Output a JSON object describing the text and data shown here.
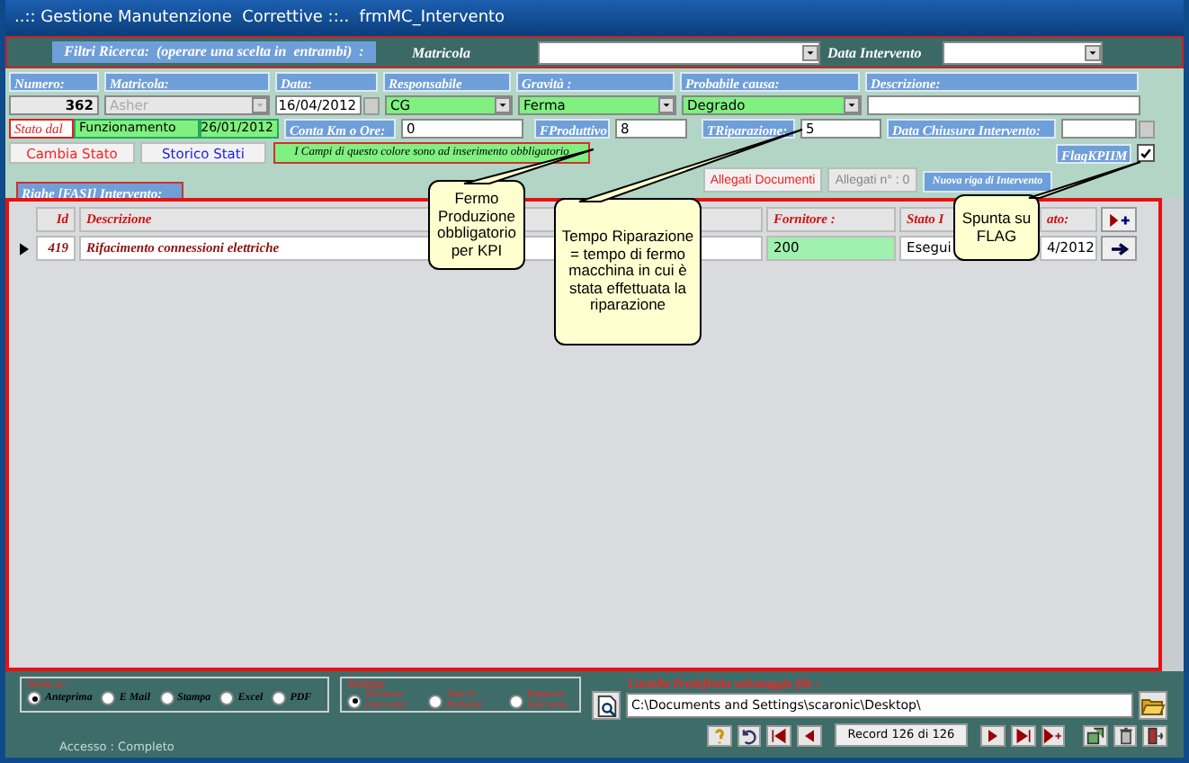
{
  "window": {
    "title": "..:: Gestione Manutenzione  Correttive ::..  frmMC_Intervento"
  },
  "filter_bar": {
    "label": "Filtri Ricerca:  (operare una scelta in  entrambi)  :",
    "fields": [
      {
        "label": "Matricola"
      },
      {
        "label": "Data Intervento"
      }
    ]
  },
  "form": {
    "numero": {
      "label": "Numero:",
      "value": "362"
    },
    "matricola": {
      "label": "Matricola:",
      "value": "Asher",
      "disabled": true
    },
    "data": {
      "label": "Data:",
      "value": "16/04/2012"
    },
    "responsabile": {
      "label": "Responsabile",
      "value": "CG",
      "required": true
    },
    "gravita": {
      "label": "Gravità :",
      "value": "Ferma",
      "required": true
    },
    "causa": {
      "label": "Probabile causa:",
      "value": "Degrado",
      "required": true
    },
    "descrizione": {
      "label": "Descrizione:"
    },
    "stato": {
      "label": "Stato dal",
      "value": "Funzionamento",
      "date": "26/01/2012",
      "required": true
    },
    "conta_km": {
      "label": "Conta Km o Ore:",
      "value": "0"
    },
    "fproduttivo": {
      "label": "FProduttivo",
      "value": "8"
    },
    "triparazione": {
      "label": "TRiparazione:",
      "value": "5"
    },
    "data_chiusura": {
      "label": "Data Chiusura Intervento:"
    },
    "state_buttons": [
      {
        "label": "Cambia Stato",
        "color": "#ff2020"
      },
      {
        "label": "Storico Stati",
        "color": "#2020e0"
      }
    ],
    "notice": "I Campi di questo colore sono ad inserimento obbligatorio",
    "flag": {
      "label": "FlagKPIIM",
      "checked": true
    },
    "attach_buttons": [
      {
        "label": "Allegati Documenti",
        "disabled": false
      },
      {
        "label": "Allegati n° : 0",
        "disabled": true
      }
    ],
    "new_row_button": "Nuova riga di Intervento",
    "rows_label": "Righe [FASI] Intervento:"
  },
  "subform": {
    "columns": {
      "id": "Id",
      "descrizione": "Descrizione",
      "fornitore": "Fornitore :",
      "column_5": "Stato I",
      "column_6": "ato:"
    },
    "rows": [
      {
        "selected": true,
        "id": "419",
        "descrizione": "Rifacimento connessioni elettriche",
        "fornitore": "200",
        "column_5": "Esegui",
        "column_6": "4/2012"
      }
    ]
  },
  "callouts": [
    {
      "text": "Fermo Produzione obbligatorio per KPI"
    },
    {
      "text": "Tempo Riparazione = tempo di fermo macchina in cui è stata effettuata la riparazione"
    },
    {
      "text": "Spunta su FLAG"
    }
  ],
  "send_to": {
    "label": "Invia a :",
    "options": [
      {
        "label": "Anteprima",
        "selected": true
      },
      {
        "label": "E Mail",
        "selected": false
      },
      {
        "label": "Stampa",
        "selected": false
      },
      {
        "label": "Excel",
        "selected": false
      },
      {
        "label": "PDF",
        "selected": false
      }
    ]
  },
  "print": {
    "label": "Stampa",
    "options": [
      {
        "label": "Richiesta Intervento",
        "selected": true
      },
      {
        "label": "Tutte le Richieste",
        "selected": false
      },
      {
        "label": "Rapporto Intervento",
        "selected": false
      }
    ]
  },
  "folder": {
    "label": "Cartella Predefinita salvataggio file :",
    "value": "C:\\Documents and Settings\\scaronic\\Desktop\\"
  },
  "access": "Accesso : Completo",
  "record": "Record 126 di 126"
}
